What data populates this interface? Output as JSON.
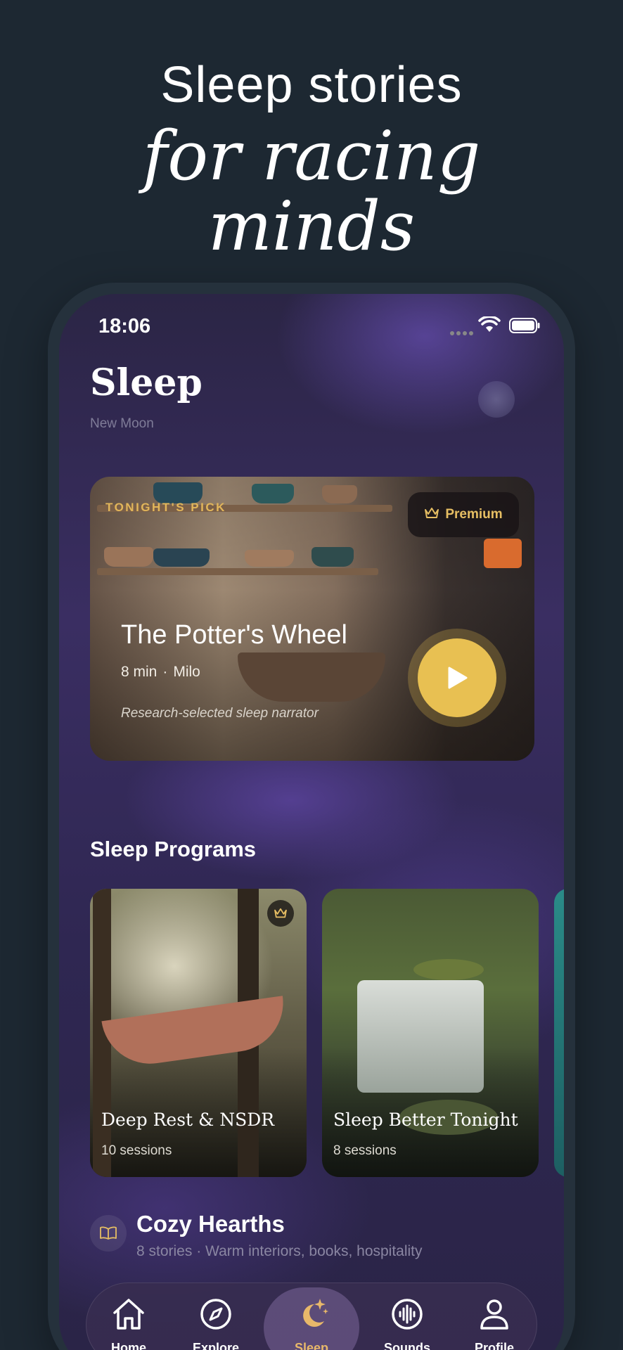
{
  "headline": {
    "line1": "Sleep stories",
    "line2": "for racing",
    "line3": "minds"
  },
  "status": {
    "time": "18:06"
  },
  "page": {
    "title": "Sleep",
    "subtitle": "New Moon"
  },
  "featured": {
    "tag": "TONIGHT'S PICK",
    "premium_label": "Premium",
    "title": "The Potter's Wheel",
    "duration": "8 min",
    "separator": "·",
    "narrator": "Milo",
    "description": "Research-selected sleep narrator"
  },
  "programs": {
    "title": "Sleep Programs",
    "items": [
      {
        "title": "Deep Rest & NSDR",
        "count": "10 sessions",
        "premium": true
      },
      {
        "title": "Sleep Better Tonight",
        "count": "8 sessions",
        "premium": false
      }
    ]
  },
  "collection": {
    "title": "Cozy Hearths",
    "subtitle": "8 stories · Warm interiors, books, hospitality"
  },
  "tabs": [
    {
      "label": "Home",
      "icon": "home-icon"
    },
    {
      "label": "Explore",
      "icon": "compass-icon"
    },
    {
      "label": "Sleep",
      "icon": "moon-stars-icon",
      "active": true
    },
    {
      "label": "Sounds",
      "icon": "sound-wave-icon"
    },
    {
      "label": "Profile",
      "icon": "person-icon"
    }
  ],
  "colors": {
    "background": "#1d2832",
    "accent_gold": "#e8c052",
    "active_tab": "#e8b86a"
  }
}
